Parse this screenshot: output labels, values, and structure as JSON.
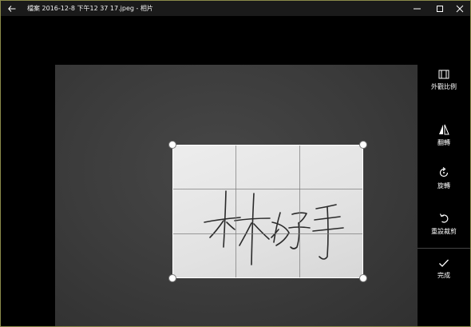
{
  "window": {
    "title": "檔案 2016-12-8 下午12 37 17.jpeg - 相片"
  },
  "toolbar": {
    "items": [
      {
        "label": "外觀比例",
        "icon": "aspect-ratio-icon"
      },
      {
        "label": "翻轉",
        "icon": "flip-icon"
      },
      {
        "label": "旋轉",
        "icon": "rotate-icon"
      },
      {
        "label": "重設裁剪",
        "icon": "reset-icon"
      },
      {
        "label": "完成",
        "icon": "checkmark-icon"
      }
    ]
  },
  "photo": {
    "handwriting": "林好手"
  },
  "colors": {
    "background": "#000000",
    "canvas": "#3c3c3c",
    "photo_paper": "#e4e4e4",
    "accent_border": "#8a8a4a"
  }
}
